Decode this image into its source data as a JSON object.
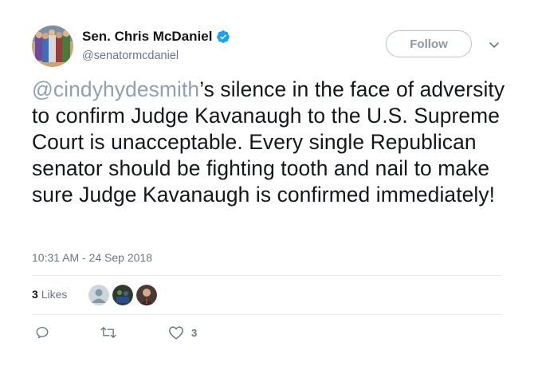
{
  "header": {
    "display_name": "Sen. Chris McDaniel",
    "handle": "@senatormcdaniel",
    "follow_label": "Follow"
  },
  "tweet": {
    "mention": "@cindyhydesmith",
    "body": "’s silence in the face of adversity to confirm Judge Kavanaugh to the U.S. Supreme Court is unacceptable. Every single Republican senator should be fighting tooth and nail to make sure Judge Kavanaugh is confirmed immediately!",
    "timestamp": "10:31 AM - 24 Sep 2018"
  },
  "engagement": {
    "likes_count": "3",
    "likes_label": "Likes"
  },
  "actions": {
    "reply_count": "",
    "retweet_count": "",
    "like_count": "3"
  },
  "colors": {
    "verified": "#1da1f2",
    "mention": "#8ea0b3",
    "muted": "#657786"
  }
}
